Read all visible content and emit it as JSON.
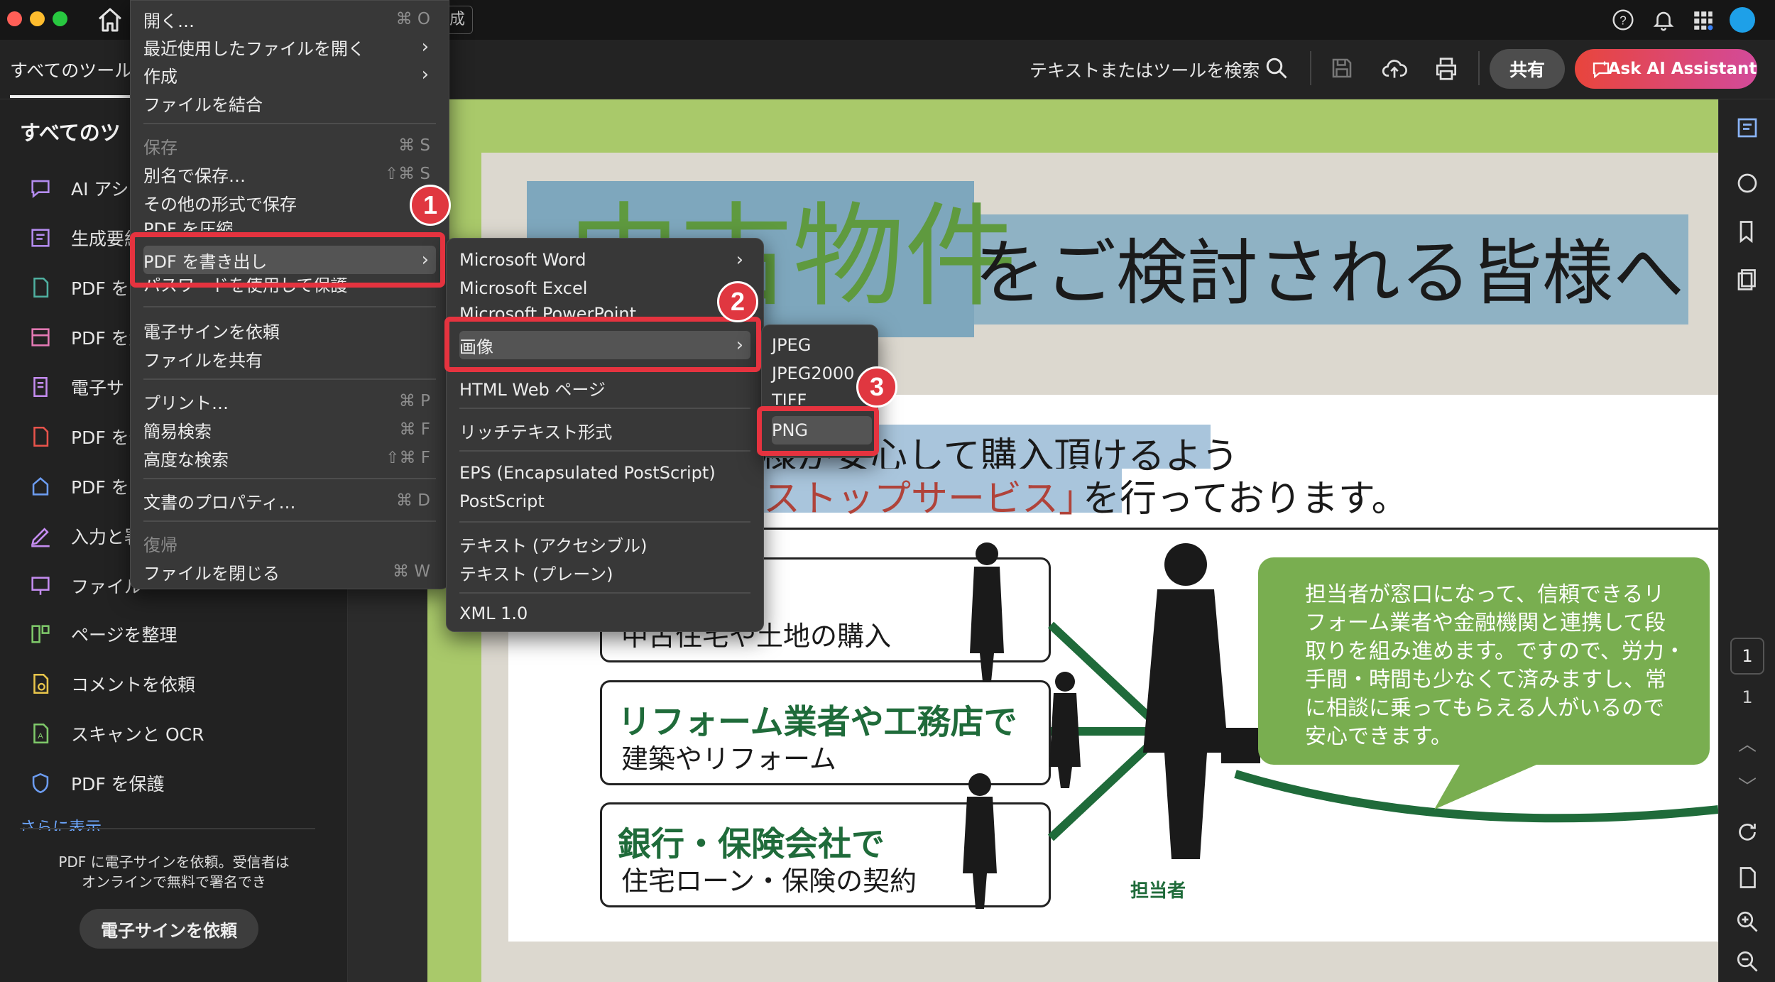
{
  "app": {
    "title_fragment": "成",
    "search_placeholder": "テキストまたはツールを検索",
    "share_label": "共有",
    "ai_label": "Ask AI Assistant",
    "accent": "#e5333f"
  },
  "tabs": {
    "all_tools": "すべてのツール"
  },
  "sidebar": {
    "heading": "すべてのツ",
    "items": [
      {
        "label": "AI アシス",
        "icon": "ai-assistant-icon"
      },
      {
        "label": "生成要約",
        "icon": "summary-icon"
      },
      {
        "label": "PDF を書",
        "icon": "export-pdf-icon"
      },
      {
        "label": "PDF を編",
        "icon": "edit-pdf-icon"
      },
      {
        "label": "電子サ",
        "icon": "esign-icon"
      },
      {
        "label": "PDF を作",
        "icon": "create-pdf-icon"
      },
      {
        "label": "PDF をス",
        "icon": "scan-pdf-icon"
      },
      {
        "label": "入力と署",
        "icon": "fill-sign-icon"
      },
      {
        "label": "ファイル",
        "icon": "combine-files-icon"
      },
      {
        "label": "ページを整理",
        "icon": "organize-pages-icon"
      },
      {
        "label": "コメントを依頼",
        "icon": "comment-request-icon"
      },
      {
        "label": "スキャンと OCR",
        "icon": "scan-ocr-icon"
      },
      {
        "label": "PDF を保護",
        "icon": "protect-pdf-icon"
      }
    ],
    "more": "さらに表示",
    "promo_line1": "PDF に電子サインを依頼。受信者は",
    "promo_line2": "オンラインで無料で署名でき",
    "promo_button": "電子サインを依頼"
  },
  "file_menu": {
    "items": [
      {
        "label": "開く…",
        "shortcut": "⌘ O"
      },
      {
        "label": "最近使用したファイルを開く",
        "submenu": true
      },
      {
        "label": "作成",
        "submenu": true
      },
      {
        "label": "ファイルを結合"
      },
      {
        "label": "保存",
        "shortcut": "⌘ S",
        "disabled": true
      },
      {
        "label": "別名で保存…",
        "shortcut": "⇧⌘ S"
      },
      {
        "label": "その他の形式で保存"
      },
      {
        "label": "PDF を圧縮"
      },
      {
        "label": "PDF を書き出し",
        "submenu": true,
        "selected": true
      },
      {
        "label": "パスワードを使用して保護"
      },
      {
        "label": "電子サインを依頼"
      },
      {
        "label": "ファイルを共有"
      },
      {
        "label": "プリント…",
        "shortcut": "⌘ P"
      },
      {
        "label": "簡易検索",
        "shortcut": "⌘ F"
      },
      {
        "label": "高度な検索",
        "shortcut": "⇧⌘ F"
      },
      {
        "label": "文書のプロパティ…",
        "shortcut": "⌘ D"
      },
      {
        "label": "復帰",
        "disabled": true
      },
      {
        "label": "ファイルを閉じる",
        "shortcut": "⌘ W"
      }
    ]
  },
  "export_menu": {
    "items": [
      {
        "label": "Microsoft Word",
        "submenu": true
      },
      {
        "label": "Microsoft Excel"
      },
      {
        "label": "Microsoft PowerPoint"
      },
      {
        "label": "画像",
        "submenu": true,
        "selected": true
      },
      {
        "label": "HTML Web ページ"
      },
      {
        "label": "リッチテキスト形式"
      },
      {
        "label": "EPS (Encapsulated PostScript)"
      },
      {
        "label": "PostScript"
      },
      {
        "label": "テキスト (アクセシブル)"
      },
      {
        "label": "テキスト (プレーン)"
      },
      {
        "label": "XML 1.0"
      }
    ]
  },
  "image_menu": {
    "items": [
      {
        "label": "JPEG"
      },
      {
        "label": "JPEG2000"
      },
      {
        "label": "TIFF"
      },
      {
        "label": "PNG",
        "selected": true
      }
    ]
  },
  "badges": [
    "1",
    "2",
    "3"
  ],
  "document": {
    "heading_big": "中古物件",
    "heading_rest": "をご検討される皆様へ",
    "line1": "様が安心して購入頂けるよう",
    "line2a": "ストップサービス」",
    "line2b": "を行っております。",
    "row1_sub": "中古住宅や土地の購入",
    "row2_title": "リフォーム業者や工務店で",
    "row2_sub": "建築やリフォーム",
    "row3_title": "銀行・保険会社で",
    "row3_sub": "住宅ローン・保険の契約",
    "bubble": [
      "担当者が窓口になって、信頼できるリ",
      "フォーム業者や金融機関と連携して段",
      "取りを組み進めます。ですので、労力・",
      "手間・時間も少なくて済みますし、常",
      "に相談に乗ってもらえる人がいるので",
      "安心できます。"
    ],
    "person_label": "担当者",
    "brand_green": "#6aa84f",
    "dark_green": "#1f6b3a"
  },
  "pager": {
    "current": "1",
    "total": "1"
  }
}
